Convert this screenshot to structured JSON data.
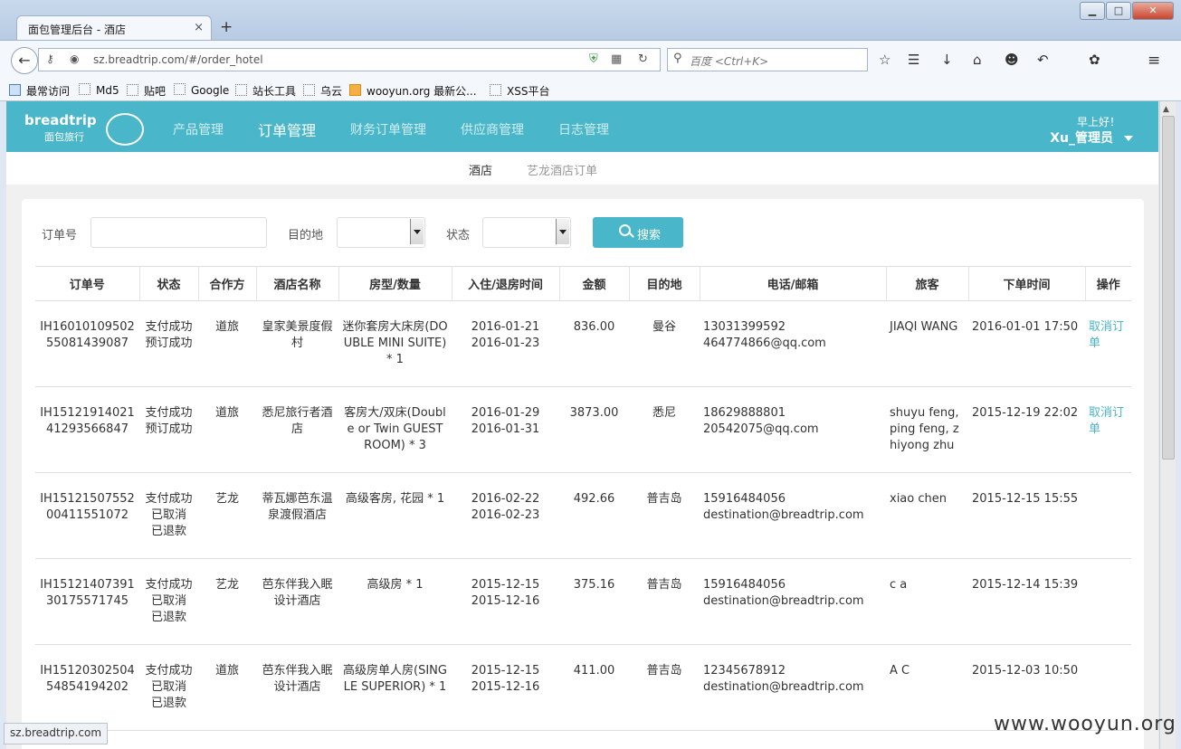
{
  "browser": {
    "tab_title": "面包管理后台 - 酒店",
    "tab_close": "×",
    "new_tab": "+",
    "win_min": "▁",
    "win_max": "□",
    "win_close": "✕",
    "url": "sz.breadtrip.com/#/order_hotel",
    "search_placeholder": "百度 <Ctrl+K>",
    "status_url": "sz.breadtrip.com",
    "bookmarks": [
      "最常访问",
      "Md5",
      "贴吧",
      "Google",
      "站长工具",
      "乌云",
      "wooyun.org 最新公...",
      "XSS平台"
    ]
  },
  "app": {
    "logo_text": "breadtrip",
    "logo_sub": "面包旅行",
    "nav": [
      "产品管理",
      "订单管理",
      "财务订单管理",
      "供应商管理",
      "日志管理"
    ],
    "greeting": "早上好！",
    "username": "Xu_管理员",
    "subtabs": [
      "酒店",
      "艺龙酒店订单"
    ]
  },
  "filters": {
    "order_no_label": "订单号",
    "dest_label": "目的地",
    "status_label": "状态",
    "search_button": "搜索"
  },
  "table": {
    "headers": [
      "订单号",
      "状态",
      "合作方",
      "酒店名称",
      "房型/数量",
      "入住/退房时间",
      "金额",
      "目的地",
      "电话/邮箱",
      "旅客",
      "下单时间",
      "操作"
    ],
    "rows": [
      {
        "order_no": "IH1601010950255081439087",
        "status": [
          "支付成功",
          "预订成功"
        ],
        "partner": "道旅",
        "hotel": "皇家美景度假村",
        "room": "迷你套房大床房(DOUBLE MINI SUITE) * 1",
        "checkin": "2016-01-21",
        "checkout": "2016-01-23",
        "amount": "836.00",
        "dest": "曼谷",
        "phone": "13031399592",
        "email": "464774866@qq.com",
        "guest": "JIAQI WANG",
        "ordered": "2016-01-01 17:50",
        "action": "取消订单"
      },
      {
        "order_no": "IH1512191402141293566847",
        "status": [
          "支付成功",
          "预订成功"
        ],
        "partner": "道旅",
        "hotel": "悉尼旅行者酒店",
        "room": "客房大/双床(Double or Twin GUEST ROOM) * 3",
        "checkin": "2016-01-29",
        "checkout": "2016-01-31",
        "amount": "3873.00",
        "dest": "悉尼",
        "phone": "18629888801",
        "email": "20542075@qq.com",
        "guest": "shuyu feng, ping feng, zhiyong zhu",
        "ordered": "2015-12-19 22:02",
        "action": "取消订单"
      },
      {
        "order_no": "IH1512150755200411551072",
        "status": [
          "支付成功",
          "已取消",
          "已退款"
        ],
        "partner": "艺龙",
        "hotel": "蒂瓦娜芭东温泉渡假酒店",
        "room": "高级客房, 花园 * 1",
        "checkin": "2016-02-22",
        "checkout": "2016-02-23",
        "amount": "492.66",
        "dest": "普吉岛",
        "phone": "15916484056",
        "email": "destination@breadtrip.com",
        "guest": "xiao chen",
        "ordered": "2015-12-15 15:55",
        "action": ""
      },
      {
        "order_no": "IH1512140739130175571745",
        "status": [
          "支付成功",
          "已取消",
          "已退款"
        ],
        "partner": "艺龙",
        "hotel": "芭东伴我入眠设计酒店",
        "room": "高级房 * 1",
        "checkin": "2015-12-15",
        "checkout": "2015-12-16",
        "amount": "375.16",
        "dest": "普吉岛",
        "phone": "15916484056",
        "email": "destination@breadtrip.com",
        "guest": "c a",
        "ordered": "2015-12-14 15:39",
        "action": ""
      },
      {
        "order_no": "IH1512030250454854194202",
        "status": [
          "支付成功",
          "已取消",
          "已退款"
        ],
        "partner": "道旅",
        "hotel": "芭东伴我入眠设计酒店",
        "room": "高级房单人房(SINGLE SUPERIOR) * 1",
        "checkin": "2015-12-15",
        "checkout": "2015-12-16",
        "amount": "411.00",
        "dest": "普吉岛",
        "phone": "12345678912",
        "email": "destination@breadtrip.com",
        "guest": "A C",
        "ordered": "2015-12-03 10:50",
        "action": ""
      }
    ]
  },
  "watermark": "www.wooyun.org",
  "colors": {
    "accent": "#4ab6c9",
    "link": "#4ab6c9"
  },
  "icons": [
    "back-arrow-icon",
    "key-icon",
    "globe-icon",
    "shield-icon",
    "qr-icon",
    "reload-icon",
    "search-icon",
    "star-icon",
    "reader-icon",
    "download-icon",
    "home-icon",
    "chat-icon",
    "undo-icon",
    "menu-icon"
  ]
}
